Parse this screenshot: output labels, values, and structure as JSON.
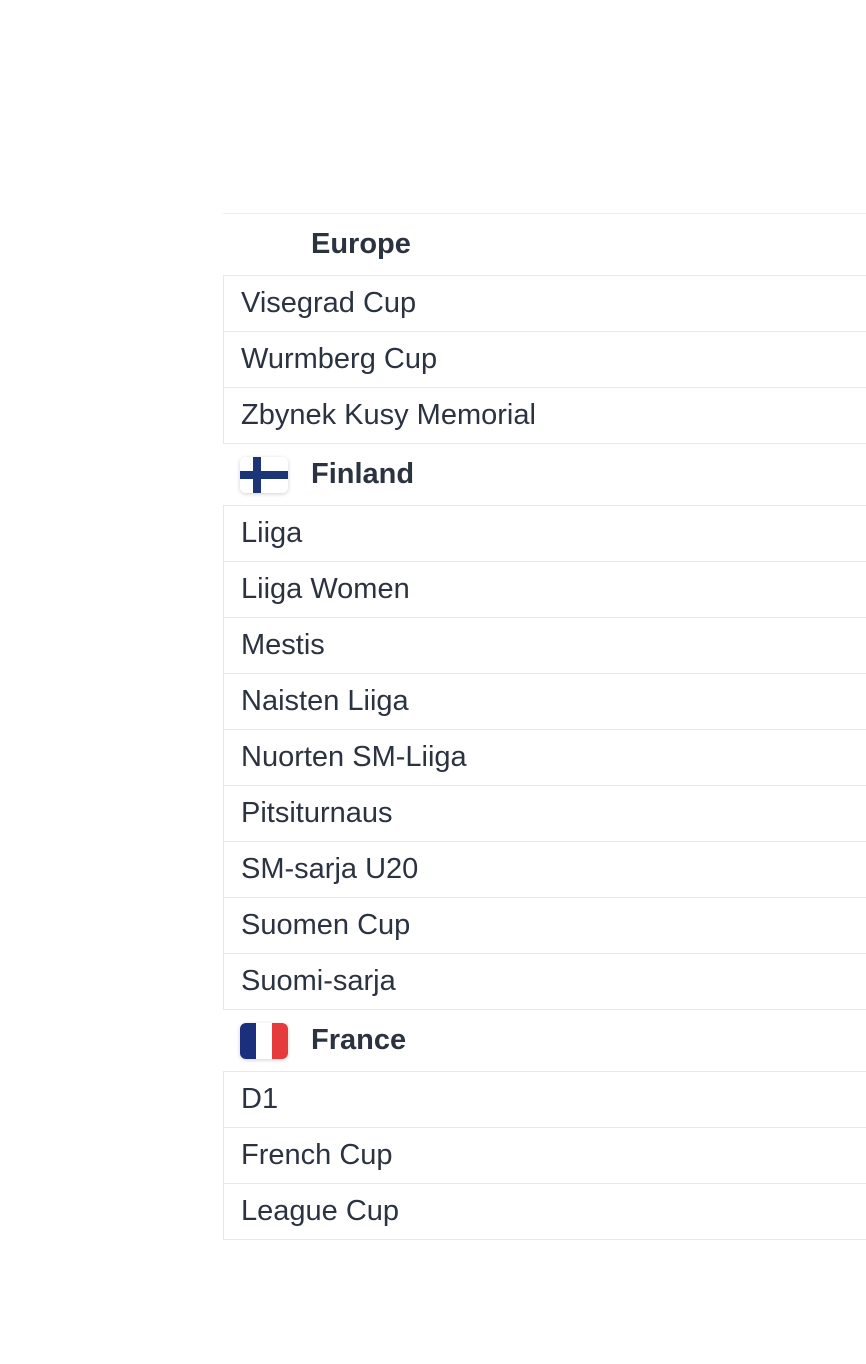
{
  "groups": [
    {
      "title": "Europe",
      "flag": "none",
      "items": [
        "Visegrad Cup",
        "Wurmberg Cup",
        "Zbynek Kusy Memorial"
      ]
    },
    {
      "title": "Finland",
      "flag": "finland-flag-icon",
      "flag_colors": {
        "field": "#ffffff",
        "cross": "#1c3578"
      },
      "items": [
        "Liiga",
        "Liiga Women",
        "Mestis",
        "Naisten Liiga",
        "Nuorten SM-Liiga",
        "Pitsiturnaus",
        "SM-sarja U20",
        "Suomen Cup",
        "Suomi-sarja"
      ]
    },
    {
      "title": "France",
      "flag": "france-flag-icon",
      "flag_colors": {
        "blue": "#1c2f7c",
        "white": "#ffffff",
        "red": "#e53b3d"
      },
      "items": [
        "D1",
        "French Cup",
        "League Cup"
      ]
    }
  ]
}
